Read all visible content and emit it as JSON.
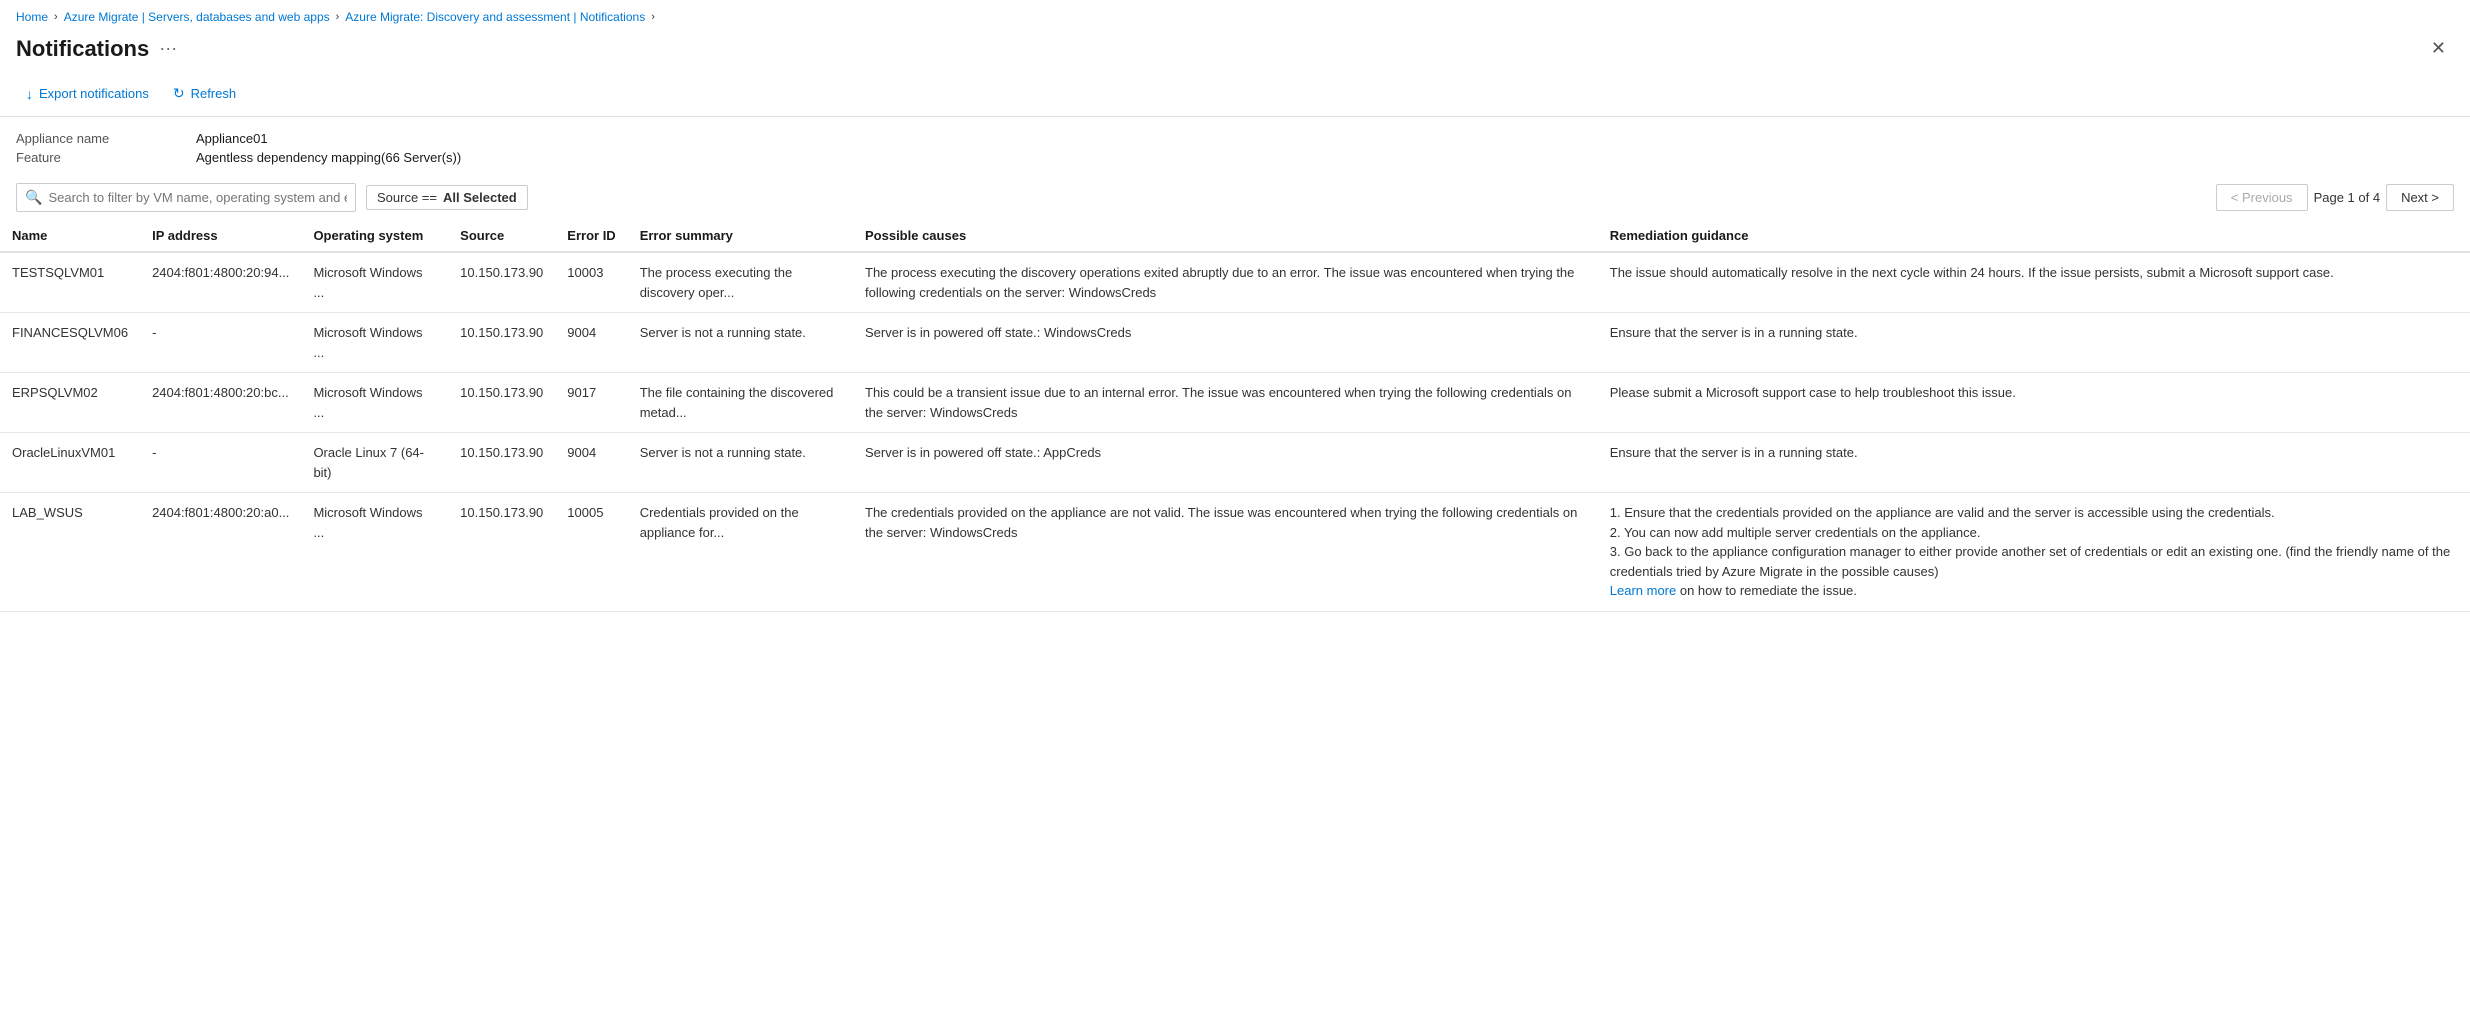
{
  "breadcrumb": {
    "items": [
      {
        "label": "Home",
        "href": true
      },
      {
        "label": "Azure Migrate | Servers, databases and web apps",
        "href": true
      },
      {
        "label": "Azure Migrate: Discovery and assessment | Notifications",
        "href": true
      }
    ]
  },
  "header": {
    "title": "Notifications",
    "more_label": "···",
    "close_label": "✕"
  },
  "toolbar": {
    "export_label": "Export notifications",
    "refresh_label": "Refresh"
  },
  "info": {
    "appliance_label": "Appliance name",
    "appliance_value": "Appliance01",
    "feature_label": "Feature",
    "feature_value": "Agentless dependency mapping(66 Server(s))"
  },
  "filter": {
    "search_placeholder": "Search to filter by VM name, operating system and error ID",
    "tag_prefix": "Source == ",
    "tag_value": "All Selected"
  },
  "pagination": {
    "previous_label": "< Previous",
    "next_label": "Next >",
    "page_info": "Page 1 of 4"
  },
  "table": {
    "columns": [
      "Name",
      "IP address",
      "Operating system",
      "Source",
      "Error ID",
      "Error summary",
      "Possible causes",
      "Remediation guidance"
    ],
    "rows": [
      {
        "name": "TESTSQLVM01",
        "ip": "2404:f801:4800:20:94...",
        "os": "Microsoft Windows ...",
        "source": "10.150.173.90",
        "error_id": "10003",
        "error_summary": "The process executing the discovery oper...",
        "possible_causes": "The process executing the discovery operations exited abruptly due to an error. The issue was encountered when trying the following credentials on the server: WindowsCreds",
        "remediation": "The issue should automatically resolve in the next cycle within 24 hours. If the issue persists, submit a Microsoft support case.",
        "has_learn_more": false
      },
      {
        "name": "FINANCESQLVM06",
        "ip": "-",
        "os": "Microsoft Windows ...",
        "source": "10.150.173.90",
        "error_id": "9004",
        "error_summary": "Server is not a running state.",
        "possible_causes": "Server is in powered off state.: WindowsCreds",
        "remediation": "Ensure that the server is in a running state.",
        "has_learn_more": false
      },
      {
        "name": "ERPSQLVM02",
        "ip": "2404:f801:4800:20:bc...",
        "os": "Microsoft Windows ...",
        "source": "10.150.173.90",
        "error_id": "9017",
        "error_summary": "The file containing the discovered metad...",
        "possible_causes": "This could be a transient issue due to an internal error. The issue was encountered when trying the following credentials on the server: WindowsCreds",
        "remediation": "Please submit a Microsoft support case to help troubleshoot this issue.",
        "has_learn_more": false
      },
      {
        "name": "OracleLinuxVM01",
        "ip": "-",
        "os": "Oracle Linux 7 (64-bit)",
        "source": "10.150.173.90",
        "error_id": "9004",
        "error_summary": "Server is not a running state.",
        "possible_causes": "Server is in powered off state.: AppCreds",
        "remediation": "Ensure that the server is in a running state.",
        "has_learn_more": false
      },
      {
        "name": "LAB_WSUS",
        "ip": "2404:f801:4800:20:a0...",
        "os": "Microsoft Windows ...",
        "source": "10.150.173.90",
        "error_id": "10005",
        "error_summary": "Credentials provided on the appliance for...",
        "possible_causes": "The credentials provided on the appliance are not valid. The issue was encountered when trying the following credentials on the server: WindowsCreds",
        "remediation": "1. Ensure that the credentials provided on the appliance are valid and the server is accessible using the credentials.\n2. You can now add multiple server credentials on the appliance.\n3. Go back to the appliance configuration manager to either provide another set of credentials or edit an existing one. (find the friendly name of the credentials tried by Azure Migrate in the possible causes)",
        "learn_more_label": "Learn more",
        "learn_more_suffix": " on how to remediate the issue.",
        "has_learn_more": true
      }
    ]
  }
}
